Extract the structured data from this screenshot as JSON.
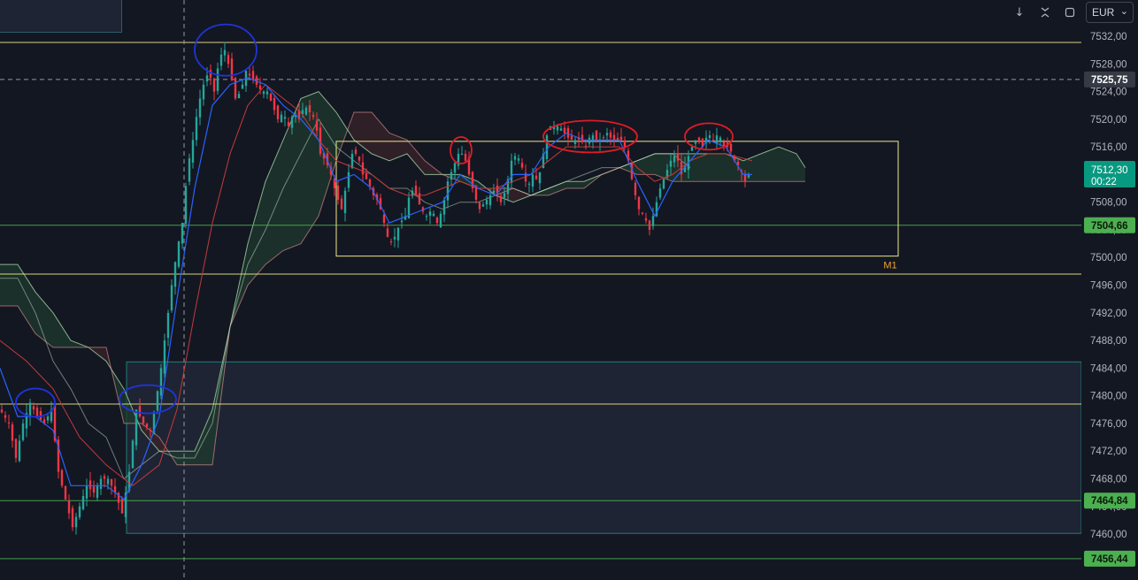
{
  "toolbar": {
    "buttons": [
      {
        "name": "scroll-down-button",
        "icon": "arrow-down-icon",
        "glyph": "↓"
      },
      {
        "name": "collapse-button",
        "icon": "collapse-icon",
        "glyph": "⨯"
      },
      {
        "name": "maximize-button",
        "icon": "maximize-icon",
        "glyph": "⛶"
      }
    ],
    "currency": "EUR",
    "currency_caret": "⌄"
  },
  "colors": {
    "background": "#131722",
    "axis_text": "#b2b5be",
    "up": "#26a69a",
    "down": "#f23645",
    "yellow_line": "#f0e68c",
    "green_line": "#4caf50",
    "zone_border": "#26a69a",
    "ma_blue": "#2962ff",
    "ma_red": "#c43a3a",
    "annotation_blue": "#1f34d9",
    "annotation_red": "#e01b24"
  },
  "chart_data": {
    "type": "candlestick",
    "symbol_currency": "EUR",
    "ylim": [
      7456.0,
      7535.0
    ],
    "y_ticks": [
      "7532,00",
      "7528,00",
      "7524,00",
      "7520,00",
      "7516,00",
      "7512,00",
      "7508,00",
      "7504,00",
      "7500,00",
      "7496,00",
      "7492,00",
      "7488,00",
      "7484,00",
      "7480,00",
      "7476,00",
      "7472,00",
      "7468,00",
      "7464,00",
      "7460,00"
    ],
    "y_tick_values": [
      7532,
      7528,
      7524,
      7520,
      7516,
      7512,
      7508,
      7504,
      7500,
      7496,
      7492,
      7488,
      7484,
      7480,
      7476,
      7472,
      7468,
      7464,
      7460
    ],
    "crosshair": {
      "price": 7525.75,
      "label": "7525,75"
    },
    "last_price": {
      "price": 7512.3,
      "label": "7512,30",
      "countdown": "00:22"
    },
    "horizontal_levels": [
      {
        "price": 7531.1,
        "color": "yellow",
        "label": ""
      },
      {
        "price": 7497.6,
        "color": "yellow",
        "label": ""
      },
      {
        "price": 7478.8,
        "color": "yellow",
        "label": ""
      },
      {
        "price": 7504.66,
        "color": "green",
        "label": "7504,66"
      },
      {
        "price": 7464.84,
        "color": "green",
        "label": "7464,84"
      },
      {
        "price": 7456.44,
        "color": "green",
        "label": "7456,44"
      }
    ],
    "range_box": {
      "top": 7516.8,
      "bottom": 7500.2,
      "label": "M1"
    },
    "demand_zone": {
      "top": 7484.9,
      "bottom": 7460.1
    },
    "close_path": [
      [
        0,
        7478
      ],
      [
        10,
        7476
      ],
      [
        18,
        7471
      ],
      [
        26,
        7476
      ],
      [
        34,
        7479
      ],
      [
        42,
        7477
      ],
      [
        50,
        7476
      ],
      [
        58,
        7478
      ],
      [
        66,
        7469
      ],
      [
        74,
        7465
      ],
      [
        82,
        7461
      ],
      [
        90,
        7464
      ],
      [
        98,
        7467
      ],
      [
        106,
        7466
      ],
      [
        114,
        7468
      ],
      [
        122,
        7468
      ],
      [
        130,
        7466
      ],
      [
        138,
        7463
      ],
      [
        146,
        7469
      ],
      [
        154,
        7478
      ],
      [
        162,
        7476
      ],
      [
        170,
        7475
      ],
      [
        176,
        7479
      ],
      [
        182,
        7484
      ],
      [
        188,
        7490
      ],
      [
        194,
        7496
      ],
      [
        200,
        7501
      ],
      [
        206,
        7505
      ],
      [
        212,
        7513
      ],
      [
        218,
        7517
      ],
      [
        224,
        7522
      ],
      [
        230,
        7525
      ],
      [
        236,
        7527
      ],
      [
        242,
        7524
      ],
      [
        248,
        7529
      ],
      [
        254,
        7530
      ],
      [
        260,
        7527
      ],
      [
        266,
        7523
      ],
      [
        272,
        7524
      ],
      [
        278,
        7527
      ],
      [
        284,
        7526
      ],
      [
        290,
        7525
      ],
      [
        296,
        7524
      ],
      [
        302,
        7524
      ],
      [
        308,
        7522
      ],
      [
        314,
        7520
      ],
      [
        320,
        7521
      ],
      [
        326,
        7519
      ],
      [
        332,
        7521
      ],
      [
        338,
        7520
      ],
      [
        344,
        7522
      ],
      [
        350,
        7521
      ],
      [
        356,
        7520
      ],
      [
        362,
        7515
      ],
      [
        368,
        7514
      ],
      [
        374,
        7512
      ],
      [
        380,
        7509
      ],
      [
        386,
        7507
      ],
      [
        392,
        7511
      ],
      [
        398,
        7515
      ],
      [
        404,
        7515
      ],
      [
        410,
        7512
      ],
      [
        416,
        7511
      ],
      [
        422,
        7509
      ],
      [
        428,
        7508
      ],
      [
        434,
        7505
      ],
      [
        440,
        7502
      ],
      [
        446,
        7503
      ],
      [
        452,
        7505
      ],
      [
        458,
        7506
      ],
      [
        464,
        7510
      ],
      [
        470,
        7509
      ],
      [
        476,
        7507
      ],
      [
        482,
        7506
      ],
      [
        488,
        7507
      ],
      [
        494,
        7505
      ],
      [
        500,
        7507
      ],
      [
        506,
        7511
      ],
      [
        512,
        7513
      ],
      [
        518,
        7515
      ],
      [
        524,
        7515
      ],
      [
        530,
        7512
      ],
      [
        536,
        7509
      ],
      [
        542,
        7507
      ],
      [
        548,
        7508
      ],
      [
        554,
        7509
      ],
      [
        560,
        7510
      ],
      [
        566,
        7508
      ],
      [
        572,
        7510
      ],
      [
        578,
        7514
      ],
      [
        584,
        7515
      ],
      [
        590,
        7513
      ],
      [
        596,
        7510
      ],
      [
        602,
        7512
      ],
      [
        608,
        7511
      ],
      [
        614,
        7515
      ],
      [
        620,
        7519
      ],
      [
        626,
        7519
      ],
      [
        632,
        7519
      ],
      [
        638,
        7518
      ],
      [
        644,
        7517
      ],
      [
        650,
        7517
      ],
      [
        656,
        7517
      ],
      [
        662,
        7516
      ],
      [
        668,
        7518
      ],
      [
        674,
        7517
      ],
      [
        680,
        7517
      ],
      [
        686,
        7518
      ],
      [
        692,
        7517
      ],
      [
        698,
        7517
      ],
      [
        704,
        7517
      ],
      [
        710,
        7514
      ],
      [
        716,
        7510
      ],
      [
        722,
        7507
      ],
      [
        728,
        7506
      ],
      [
        734,
        7504
      ],
      [
        740,
        7507
      ],
      [
        746,
        7510
      ],
      [
        752,
        7512
      ],
      [
        758,
        7514
      ],
      [
        764,
        7515
      ],
      [
        770,
        7512
      ],
      [
        776,
        7514
      ],
      [
        782,
        7516
      ],
      [
        788,
        7517
      ],
      [
        794,
        7516
      ],
      [
        800,
        7518
      ],
      [
        806,
        7517
      ],
      [
        812,
        7518
      ],
      [
        818,
        7516
      ],
      [
        824,
        7516
      ],
      [
        830,
        7514
      ],
      [
        836,
        7513
      ],
      [
        842,
        7511
      ],
      [
        846,
        7512
      ]
    ],
    "blue_ma": [
      [
        0,
        7484
      ],
      [
        20,
        7477
      ],
      [
        40,
        7477
      ],
      [
        60,
        7475
      ],
      [
        80,
        7467
      ],
      [
        100,
        7467
      ],
      [
        120,
        7467
      ],
      [
        140,
        7465
      ],
      [
        160,
        7470
      ],
      [
        180,
        7477
      ],
      [
        200,
        7494
      ],
      [
        220,
        7510
      ],
      [
        240,
        7522
      ],
      [
        260,
        7525
      ],
      [
        280,
        7526
      ],
      [
        300,
        7525
      ],
      [
        320,
        7522
      ],
      [
        340,
        7520
      ],
      [
        360,
        7517
      ],
      [
        380,
        7511
      ],
      [
        400,
        7512
      ],
      [
        420,
        7510
      ],
      [
        440,
        7505
      ],
      [
        460,
        7506
      ],
      [
        480,
        7507
      ],
      [
        500,
        7508
      ],
      [
        520,
        7512
      ],
      [
        540,
        7510
      ],
      [
        560,
        7509
      ],
      [
        580,
        7512
      ],
      [
        600,
        7512
      ],
      [
        620,
        7516
      ],
      [
        640,
        7518
      ],
      [
        660,
        7517
      ],
      [
        680,
        7517
      ],
      [
        700,
        7517
      ],
      [
        720,
        7511
      ],
      [
        740,
        7506
      ],
      [
        760,
        7511
      ],
      [
        780,
        7514
      ],
      [
        800,
        7517
      ],
      [
        820,
        7516
      ],
      [
        840,
        7512
      ],
      [
        850,
        7512
      ]
    ],
    "red_ma": [
      [
        0,
        7488
      ],
      [
        30,
        7485
      ],
      [
        60,
        7481
      ],
      [
        90,
        7474
      ],
      [
        120,
        7470
      ],
      [
        150,
        7467
      ],
      [
        180,
        7470
      ],
      [
        200,
        7478
      ],
      [
        220,
        7492
      ],
      [
        240,
        7505
      ],
      [
        260,
        7515
      ],
      [
        280,
        7522
      ],
      [
        300,
        7525
      ],
      [
        320,
        7523
      ],
      [
        340,
        7521
      ],
      [
        360,
        7517
      ],
      [
        380,
        7514
      ],
      [
        400,
        7513
      ],
      [
        420,
        7512
      ],
      [
        440,
        7510
      ],
      [
        460,
        7509
      ],
      [
        480,
        7509
      ],
      [
        500,
        7510
      ],
      [
        520,
        7511
      ],
      [
        540,
        7510
      ],
      [
        560,
        7510
      ],
      [
        580,
        7511
      ],
      [
        600,
        7512
      ],
      [
        620,
        7514
      ],
      [
        640,
        7516
      ],
      [
        660,
        7516
      ],
      [
        680,
        7516
      ],
      [
        700,
        7516
      ],
      [
        720,
        7513
      ],
      [
        740,
        7511
      ],
      [
        760,
        7512
      ],
      [
        780,
        7514
      ],
      [
        800,
        7515
      ],
      [
        820,
        7515
      ],
      [
        850,
        7514
      ]
    ],
    "cloud_green": [
      [
        0,
        7499
      ],
      [
        20,
        7499
      ],
      [
        40,
        7495
      ],
      [
        60,
        7492
      ],
      [
        80,
        7488
      ],
      [
        100,
        7487
      ],
      [
        120,
        7485
      ],
      [
        140,
        7481
      ],
      [
        160,
        7475
      ],
      [
        180,
        7472
      ],
      [
        200,
        7472
      ],
      [
        220,
        7472
      ],
      [
        240,
        7478
      ],
      [
        260,
        7490
      ],
      [
        280,
        7502
      ],
      [
        300,
        7511
      ],
      [
        320,
        7517
      ],
      [
        340,
        7523
      ],
      [
        360,
        7524
      ],
      [
        380,
        7521
      ],
      [
        400,
        7517
      ],
      [
        420,
        7515
      ],
      [
        440,
        7514
      ],
      [
        460,
        7515
      ],
      [
        480,
        7512
      ],
      [
        500,
        7512
      ],
      [
        520,
        7512
      ],
      [
        540,
        7511
      ],
      [
        560,
        7509
      ],
      [
        580,
        7508
      ],
      [
        600,
        7509
      ],
      [
        620,
        7510
      ],
      [
        640,
        7511
      ],
      [
        660,
        7511
      ],
      [
        680,
        7512
      ],
      [
        700,
        7513
      ],
      [
        720,
        7514
      ],
      [
        740,
        7515
      ],
      [
        760,
        7515
      ],
      [
        780,
        7515
      ],
      [
        800,
        7515
      ],
      [
        820,
        7515
      ],
      [
        840,
        7514
      ],
      [
        860,
        7515
      ],
      [
        880,
        7516
      ],
      [
        900,
        7515
      ],
      [
        910,
        7513
      ]
    ],
    "cloud_red": [
      [
        0,
        7493
      ],
      [
        20,
        7493
      ],
      [
        40,
        7489
      ],
      [
        60,
        7487
      ],
      [
        80,
        7487
      ],
      [
        100,
        7487
      ],
      [
        120,
        7487
      ],
      [
        140,
        7476
      ],
      [
        160,
        7476
      ],
      [
        180,
        7474
      ],
      [
        200,
        7470
      ],
      [
        220,
        7470
      ],
      [
        240,
        7470
      ],
      [
        260,
        7490
      ],
      [
        280,
        7496
      ],
      [
        300,
        7499
      ],
      [
        320,
        7501
      ],
      [
        340,
        7502
      ],
      [
        360,
        7506
      ],
      [
        380,
        7514
      ],
      [
        400,
        7521
      ],
      [
        420,
        7521
      ],
      [
        440,
        7518
      ],
      [
        460,
        7517
      ],
      [
        480,
        7514
      ],
      [
        500,
        7512
      ],
      [
        520,
        7511
      ],
      [
        540,
        7510
      ],
      [
        560,
        7510
      ],
      [
        580,
        7510
      ],
      [
        600,
        7509
      ],
      [
        620,
        7509
      ],
      [
        640,
        7510
      ],
      [
        660,
        7510
      ],
      [
        680,
        7512
      ],
      [
        700,
        7513
      ],
      [
        720,
        7512
      ],
      [
        740,
        7512
      ],
      [
        760,
        7511
      ],
      [
        780,
        7511
      ],
      [
        800,
        7511
      ],
      [
        820,
        7511
      ],
      [
        840,
        7511
      ],
      [
        860,
        7511
      ],
      [
        880,
        7511
      ],
      [
        910,
        7511
      ]
    ],
    "lagging_line": [
      [
        0,
        7497
      ],
      [
        20,
        7497
      ],
      [
        40,
        7492
      ],
      [
        60,
        7485
      ],
      [
        80,
        7481
      ],
      [
        100,
        7476
      ],
      [
        120,
        7474
      ],
      [
        140,
        7468
      ],
      [
        160,
        7470
      ],
      [
        180,
        7472
      ],
      [
        200,
        7471
      ],
      [
        220,
        7471
      ],
      [
        240,
        7476
      ],
      [
        260,
        7490
      ],
      [
        280,
        7499
      ],
      [
        300,
        7504
      ],
      [
        320,
        7510
      ],
      [
        340,
        7515
      ],
      [
        360,
        7520
      ],
      [
        380,
        7516
      ],
      [
        400,
        7514
      ],
      [
        420,
        7512
      ],
      [
        440,
        7510
      ],
      [
        460,
        7510
      ],
      [
        480,
        7508
      ],
      [
        500,
        7507
      ],
      [
        520,
        7508
      ],
      [
        540,
        7508
      ],
      [
        560,
        7509
      ],
      [
        580,
        7510
      ],
      [
        600,
        7509
      ],
      [
        620,
        7510
      ],
      [
        640,
        7511
      ],
      [
        660,
        7512
      ],
      [
        680,
        7513
      ],
      [
        700,
        7513
      ],
      [
        720,
        7514
      ],
      [
        740,
        7515
      ],
      [
        760,
        7515
      ],
      [
        780,
        7513
      ]
    ],
    "annotations": [
      {
        "type": "circle",
        "color": "blue",
        "center": [
          40,
          7479
        ]
      },
      {
        "type": "circle",
        "color": "blue",
        "center": [
          167,
          7479.5
        ]
      },
      {
        "type": "circle",
        "color": "blue",
        "center": [
          255,
          7530
        ]
      },
      {
        "type": "circle",
        "color": "red",
        "center": [
          521,
          7515.5
        ]
      },
      {
        "type": "circle",
        "color": "red",
        "center": [
          667,
          7517.5
        ]
      },
      {
        "type": "circle",
        "color": "red",
        "center": [
          801,
          7517.5
        ]
      }
    ]
  }
}
